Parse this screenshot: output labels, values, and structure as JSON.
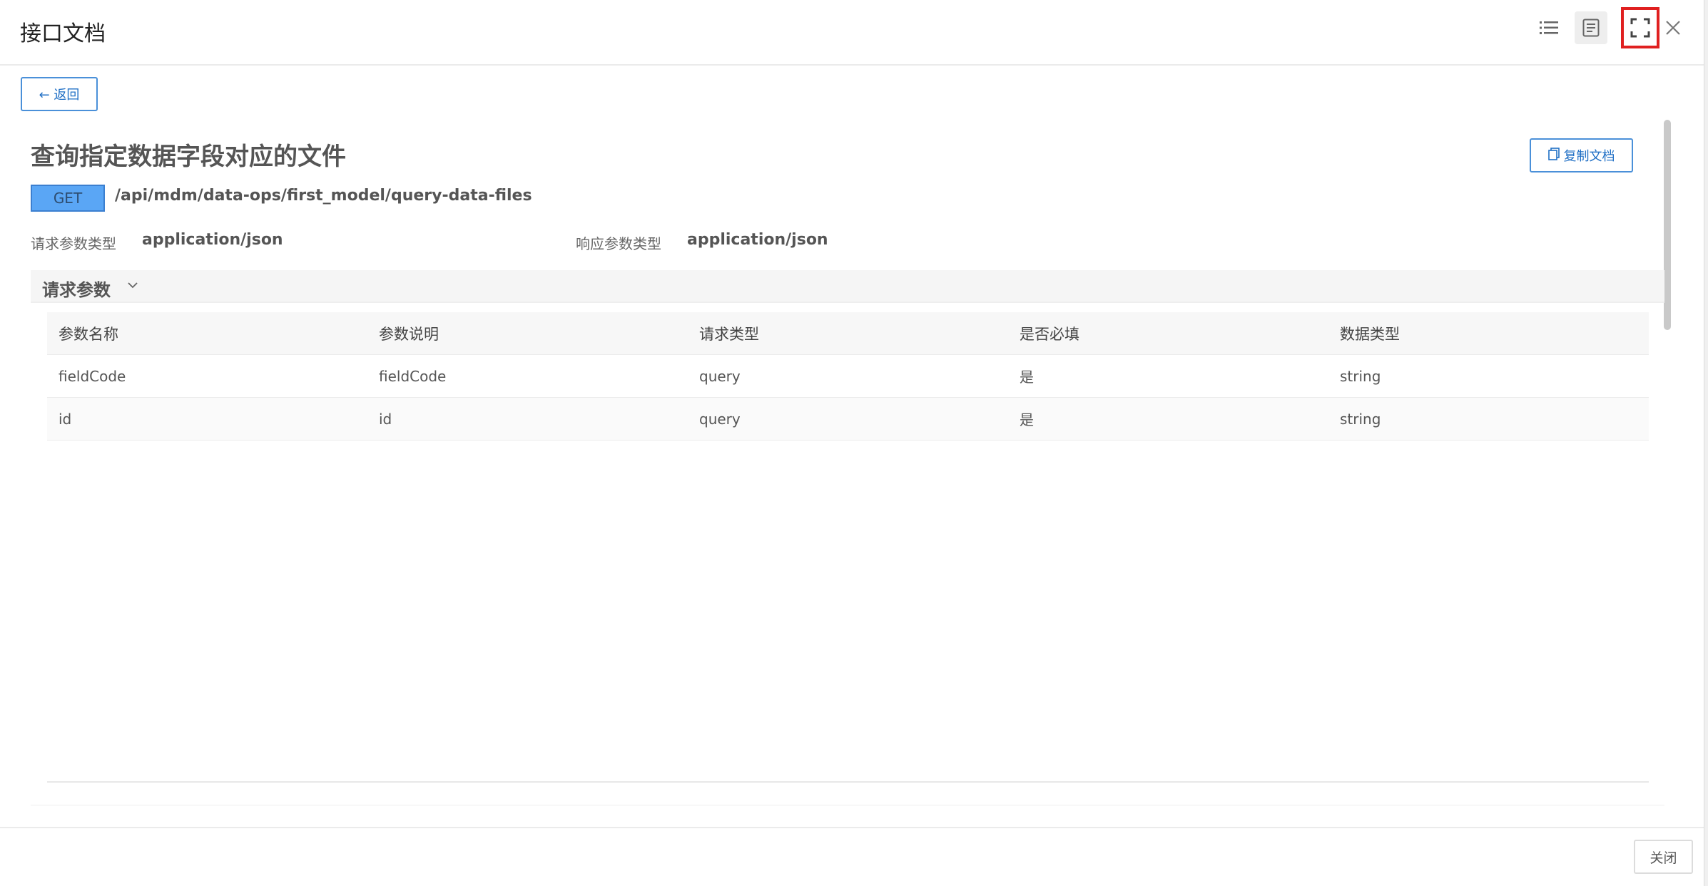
{
  "header": {
    "title": "接口文档"
  },
  "toolbar": {
    "back_label": "← 返回",
    "copy_label": "复制文档"
  },
  "doc": {
    "title": "查询指定数据字段对应的文件",
    "method": "GET",
    "path": "/api/mdm/data-ops/first_model/query-data-files",
    "request_type_label": "请求参数类型",
    "request_type_value": "application/json",
    "response_type_label": "响应参数类型",
    "response_type_value": "application/json"
  },
  "params_section": {
    "title": "请求参数",
    "columns": [
      "参数名称",
      "参数说明",
      "请求类型",
      "是否必填",
      "数据类型"
    ],
    "rows": [
      [
        "fieldCode",
        "fieldCode",
        "query",
        "是",
        "string"
      ],
      [
        "id",
        "id",
        "query",
        "是",
        "string"
      ]
    ]
  },
  "footer": {
    "close_label": "关闭"
  },
  "colors": {
    "accent": "#1f6fc5",
    "method_bg": "#5aa6f5",
    "highlight": "#e02020"
  },
  "icons": [
    "list-icon",
    "document-view-icon",
    "fullscreen-icon",
    "close-icon",
    "copy-icon",
    "chevron-down-icon"
  ]
}
